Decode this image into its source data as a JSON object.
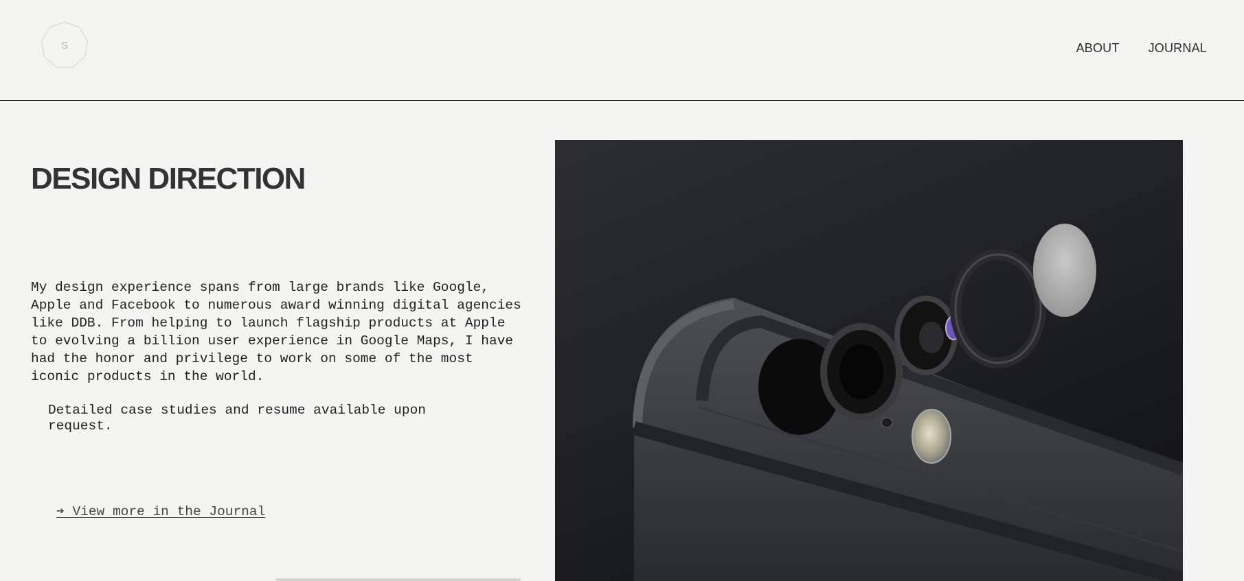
{
  "header": {
    "logo_letter": "S",
    "nav": [
      {
        "label": "ABOUT"
      },
      {
        "label": "JOURNAL"
      }
    ]
  },
  "main": {
    "title": "DESIGN DIRECTION",
    "paragraph": "My design experience spans from large brands like Google, Apple and Facebook to numerous award winning digital agencies like DDB. From helping to launch flagship products at Apple to evolving a billion user experience in Google Maps, I have had the honor and privilege to work on some of the most iconic products in the world.",
    "note": "Detailed case studies and resume available upon request.",
    "link_label": "➔ View more in the Journal"
  },
  "hero": {
    "icon": "exploded-camera-photo"
  },
  "colors": {
    "background": "#f4f4f2",
    "text": "#222222",
    "divider": "#2a2a2a"
  }
}
